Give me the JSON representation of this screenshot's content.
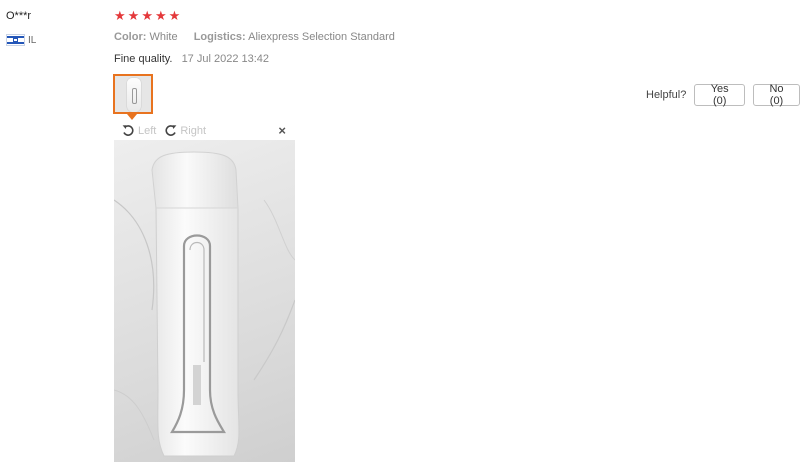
{
  "reviewer": {
    "name": "O***r",
    "country": "IL",
    "flag_icon": "israel-flag-icon"
  },
  "review": {
    "rating": 5,
    "star_icon": "star-icon",
    "star_color": "#e4383a",
    "color_label": "Color:",
    "color_value": "White",
    "logistics_label": "Logistics:",
    "logistics_value": "Aliexpress Selection Standard",
    "text": "Fine quality.",
    "date": "17 Jul 2022 13:42",
    "selected_thumb_border": "#e8731f"
  },
  "viewer": {
    "rotate_left_label": "Left",
    "rotate_right_label": "Right",
    "close_label": "×"
  },
  "helpful": {
    "label": "Helpful?",
    "yes_label": "Yes (0)",
    "no_label": "No (0)"
  }
}
